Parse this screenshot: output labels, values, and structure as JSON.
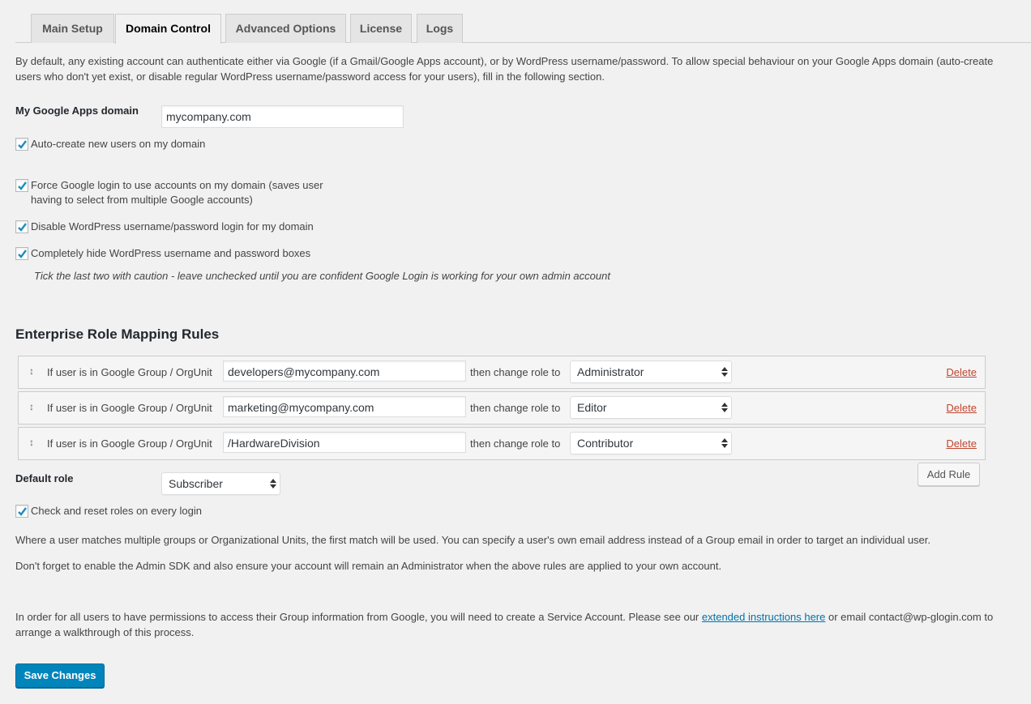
{
  "tabs": [
    {
      "label": "Main Setup",
      "active": false
    },
    {
      "label": "Domain Control",
      "active": true
    },
    {
      "label": "Advanced Options",
      "active": false
    },
    {
      "label": "License",
      "active": false
    },
    {
      "label": "Logs",
      "active": false
    }
  ],
  "intro": "By default, any existing account can authenticate either via Google (if a Gmail/Google Apps account), or by WordPress username/password. To allow special behaviour on your Google Apps domain (auto-create users who don't yet exist, or disable regular WordPress username/password access for your users), fill in the following section.",
  "domain": {
    "label": "My Google Apps domain",
    "value": "mycompany.com"
  },
  "checkboxes": {
    "auto_create": {
      "label": "Auto-create new users on my domain",
      "checked": true
    },
    "force_login_line1": "Force Google login to use accounts on my domain (saves user",
    "force_login_line2": "having to select from multiple Google accounts)",
    "force_login_checked": true,
    "disable_wp": {
      "label": "Disable WordPress username/password login for my domain",
      "checked": true
    },
    "hide_boxes": {
      "label": "Completely hide WordPress username and password boxes",
      "checked": true
    },
    "reset_roles": {
      "label": "Check and reset roles on every login",
      "checked": true
    }
  },
  "caution_note": "Tick the last two with caution - leave unchecked until you are confident Google Login is working for your own admin account",
  "role_mapping": {
    "heading": "Enterprise Role Mapping Rules",
    "rule_prefix": "If user is in Google Group / OrgUnit",
    "rule_mid": "then change role to",
    "delete_label": "Delete",
    "rules": [
      {
        "group": "developers@mycompany.com",
        "role": "Administrator"
      },
      {
        "group": "marketing@mycompany.com",
        "role": "Editor"
      },
      {
        "group": "/HardwareDivision",
        "role": "Contributor"
      }
    ],
    "add_rule_label": "Add Rule",
    "default_role_label": "Default role",
    "default_role_value": "Subscriber"
  },
  "info": {
    "multiple_match": "Where a user matches multiple groups or Organizational Units, the first match will be used. You can specify a user's own email address instead of a Group email in order to target an individual user.",
    "admin_sdk": "Don't forget to enable the Admin SDK and also ensure your account will remain an Administrator when the above rules are applied to your own account.",
    "service_account_before": "In order for all users to have permissions to access their Group information from Google, you will need to create a Service Account. Please see our ",
    "service_account_link": "extended instructions here",
    "service_account_after": " or email contact@wp-glogin.com to arrange a walkthrough of this process."
  },
  "save_label": "Save Changes",
  "colors": {
    "primary_button": "#0085ba",
    "delete_link": "#c0452e",
    "link": "#0073aa",
    "check": "#1e8cbe"
  }
}
